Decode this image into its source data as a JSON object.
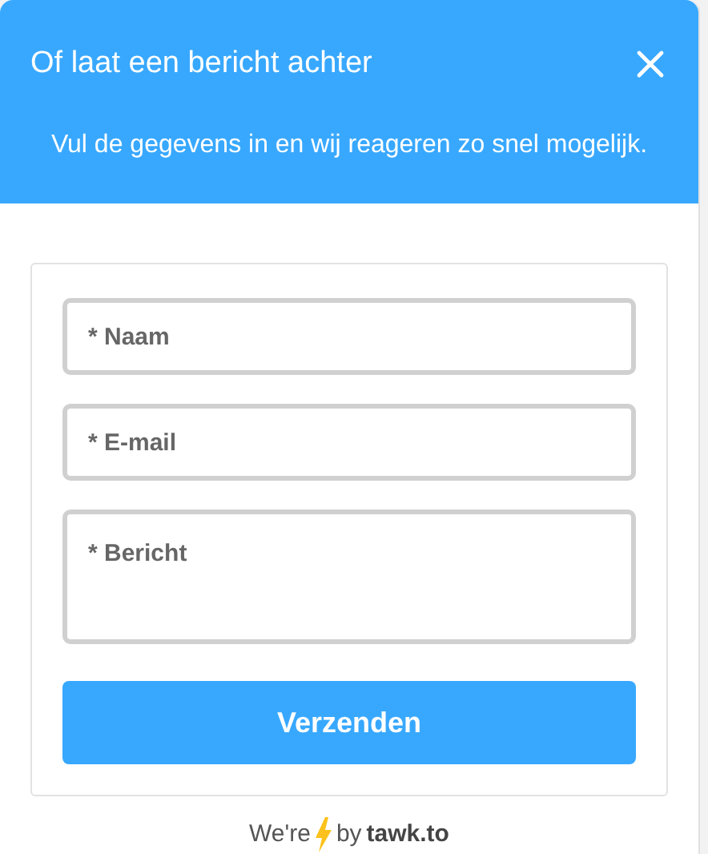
{
  "header": {
    "title": "Of laat een bericht achter",
    "subtitle": "Vul de gegevens in en wij reageren zo snel mogelijk."
  },
  "form": {
    "fields": [
      {
        "kind": "input",
        "placeholder": "* Naam"
      },
      {
        "kind": "input",
        "placeholder": "* E-mail"
      },
      {
        "kind": "textarea",
        "placeholder": "* Bericht"
      }
    ],
    "submit": "Verzenden"
  },
  "footer": {
    "prefix": "We're",
    "middle": "by",
    "brand": "tawk.to"
  }
}
